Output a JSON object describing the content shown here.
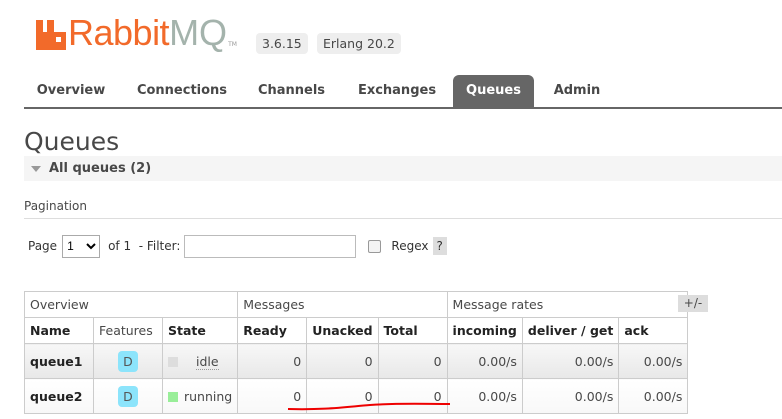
{
  "header": {
    "logo_primary": "Rabbit",
    "logo_secondary": "MQ",
    "logo_tm": "TM",
    "version": "3.6.15",
    "erlang": "Erlang 20.2"
  },
  "nav": [
    {
      "label": "Overview"
    },
    {
      "label": "Connections"
    },
    {
      "label": "Channels"
    },
    {
      "label": "Exchanges"
    },
    {
      "label": "Queues",
      "active": true
    },
    {
      "label": "Admin"
    }
  ],
  "page_title": "Queues",
  "section": "All queues (2)",
  "pagination": {
    "title": "Pagination",
    "page_label": "Page",
    "page_value": "1",
    "of_label": "of 1",
    "filter_label": "- Filter:",
    "filter_value": "",
    "regex_label": "Regex",
    "help": "?"
  },
  "table": {
    "groups": [
      "Overview",
      "Messages",
      "Message rates"
    ],
    "toggle": "+/-",
    "columns": [
      "Name",
      "Features",
      "State",
      "Ready",
      "Unacked",
      "Total",
      "incoming",
      "deliver / get",
      "ack"
    ],
    "rows": [
      {
        "name": "queue1",
        "features": "D",
        "state": "idle",
        "ready": "0",
        "unacked": "0",
        "total": "0",
        "incoming": "0.00/s",
        "deliver_get": "0.00/s",
        "ack": "0.00/s"
      },
      {
        "name": "queue2",
        "features": "D",
        "state": "running",
        "ready": "0",
        "unacked": "0",
        "total": "0",
        "incoming": "0.00/s",
        "deliver_get": "0.00/s",
        "ack": "0.00/s"
      }
    ]
  },
  "colors": {
    "brand": "#f26a2a",
    "idle": "#dddddd",
    "running": "#99ee99",
    "annotation": "#ee0000"
  }
}
